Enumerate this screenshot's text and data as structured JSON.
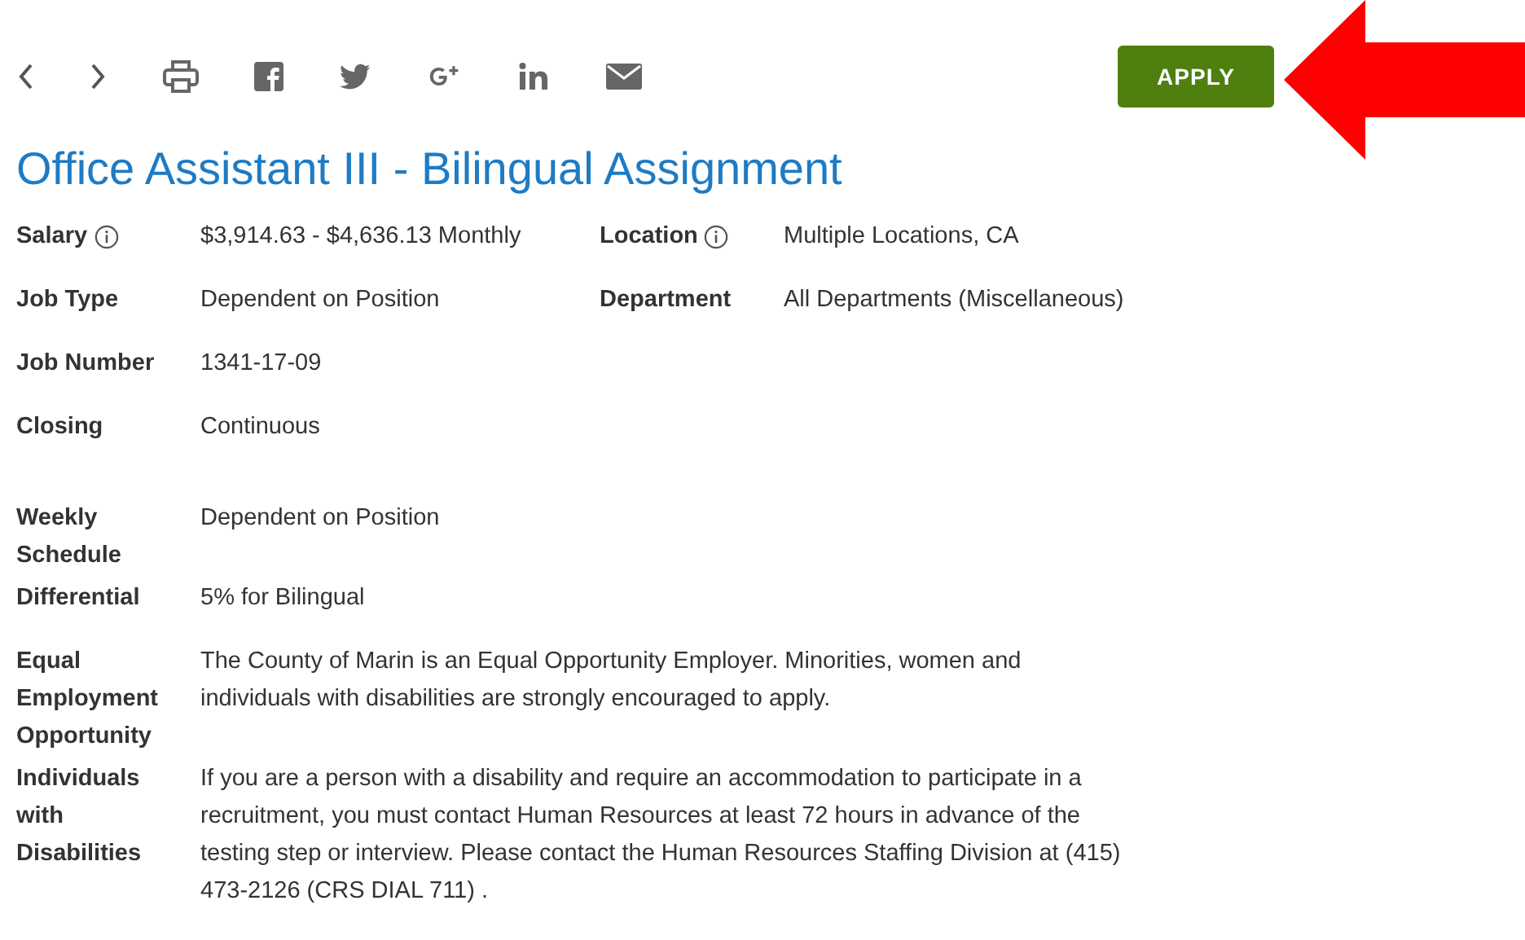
{
  "toolbar": {
    "apply_button": "APPLY"
  },
  "title": "Office Assistant III - Bilingual Assignment",
  "sections": [
    {
      "rows": [
        {
          "label": "Salary",
          "info": true,
          "value": "$3,914.63 - $4,636.13 Monthly",
          "right": {
            "label": "Location",
            "info": true,
            "value": "Multiple Locations, CA"
          }
        },
        {
          "label": "Job Type",
          "info": false,
          "value": "Dependent on Position",
          "right": {
            "label": "Department",
            "info": false,
            "value": "All Departments (Miscellaneous)"
          }
        },
        {
          "label": "Job Number",
          "info": false,
          "value": "1341-17-09"
        },
        {
          "label": "Closing",
          "info": false,
          "value": "Continuous"
        }
      ]
    },
    {
      "rows": [
        {
          "label": "Weekly Schedule",
          "info": false,
          "value": "Dependent on Position"
        },
        {
          "label": "Differential",
          "info": false,
          "value": "5% for Bilingual"
        },
        {
          "label": "Equal Employment Opportunity",
          "info": false,
          "value": "The County of Marin is an Equal Opportunity Employer. Minorities, women and individuals with disabilities are strongly encouraged to apply."
        },
        {
          "label": "Individuals with Disabilities",
          "info": false,
          "value": "If you are a person with a disability and require an accommodation to participate in a recruitment, you must contact Human Resources at least 72 hours in advance of the testing step or interview. Please contact the Human Resources Staffing Division at (415) 473-2126 (CRS DIAL 711) ."
        }
      ]
    }
  ]
}
